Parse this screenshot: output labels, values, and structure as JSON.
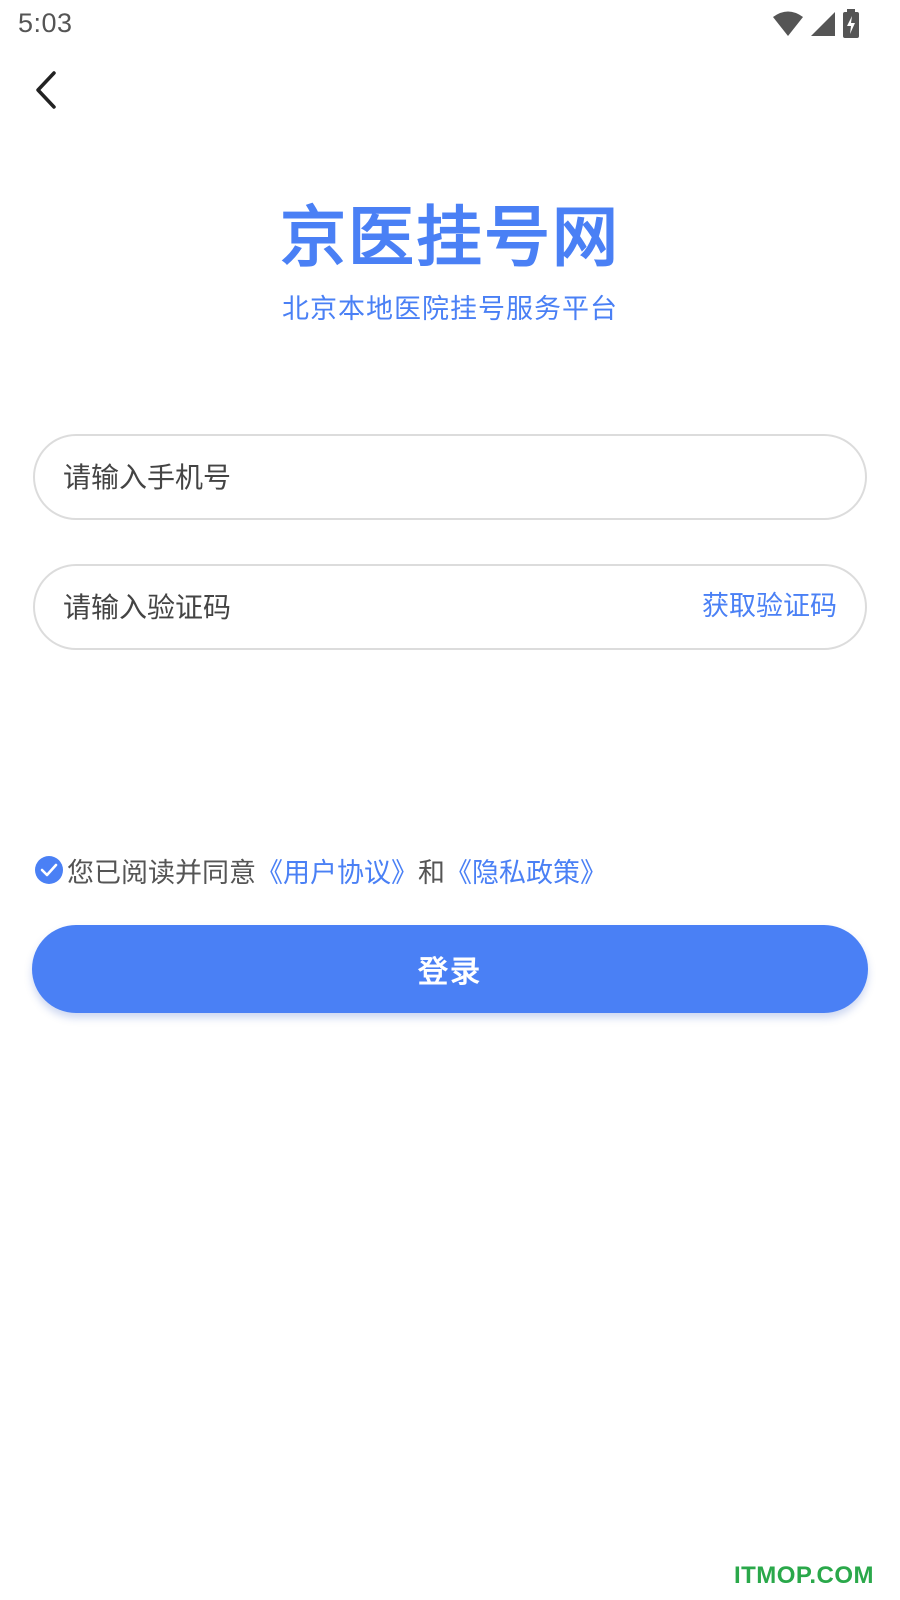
{
  "status_bar": {
    "time": "5:03",
    "icons": [
      "wifi-icon",
      "cellular-signal-icon",
      "battery-charging-icon"
    ]
  },
  "nav": {
    "back_icon": "chevron-left-icon"
  },
  "brand": {
    "title": "京医挂号网",
    "subtitle": "北京本地医院挂号服务平台"
  },
  "form": {
    "phone_placeholder": "请输入手机号",
    "phone_value": "",
    "code_placeholder": "请输入验证码",
    "code_value": "",
    "get_code_label": "获取验证码"
  },
  "agreement": {
    "checked": true,
    "prefix": "您已阅读并同意",
    "user_agreement": "《用户协议》",
    "and": "和",
    "privacy_policy": "《隐私政策》"
  },
  "login": {
    "label": "登录"
  },
  "watermark": {
    "text": "ITMOP.COM"
  },
  "colors": {
    "accent": "#4a80f5",
    "border": "#dcdcdc",
    "watermark": "#2aa84a"
  }
}
